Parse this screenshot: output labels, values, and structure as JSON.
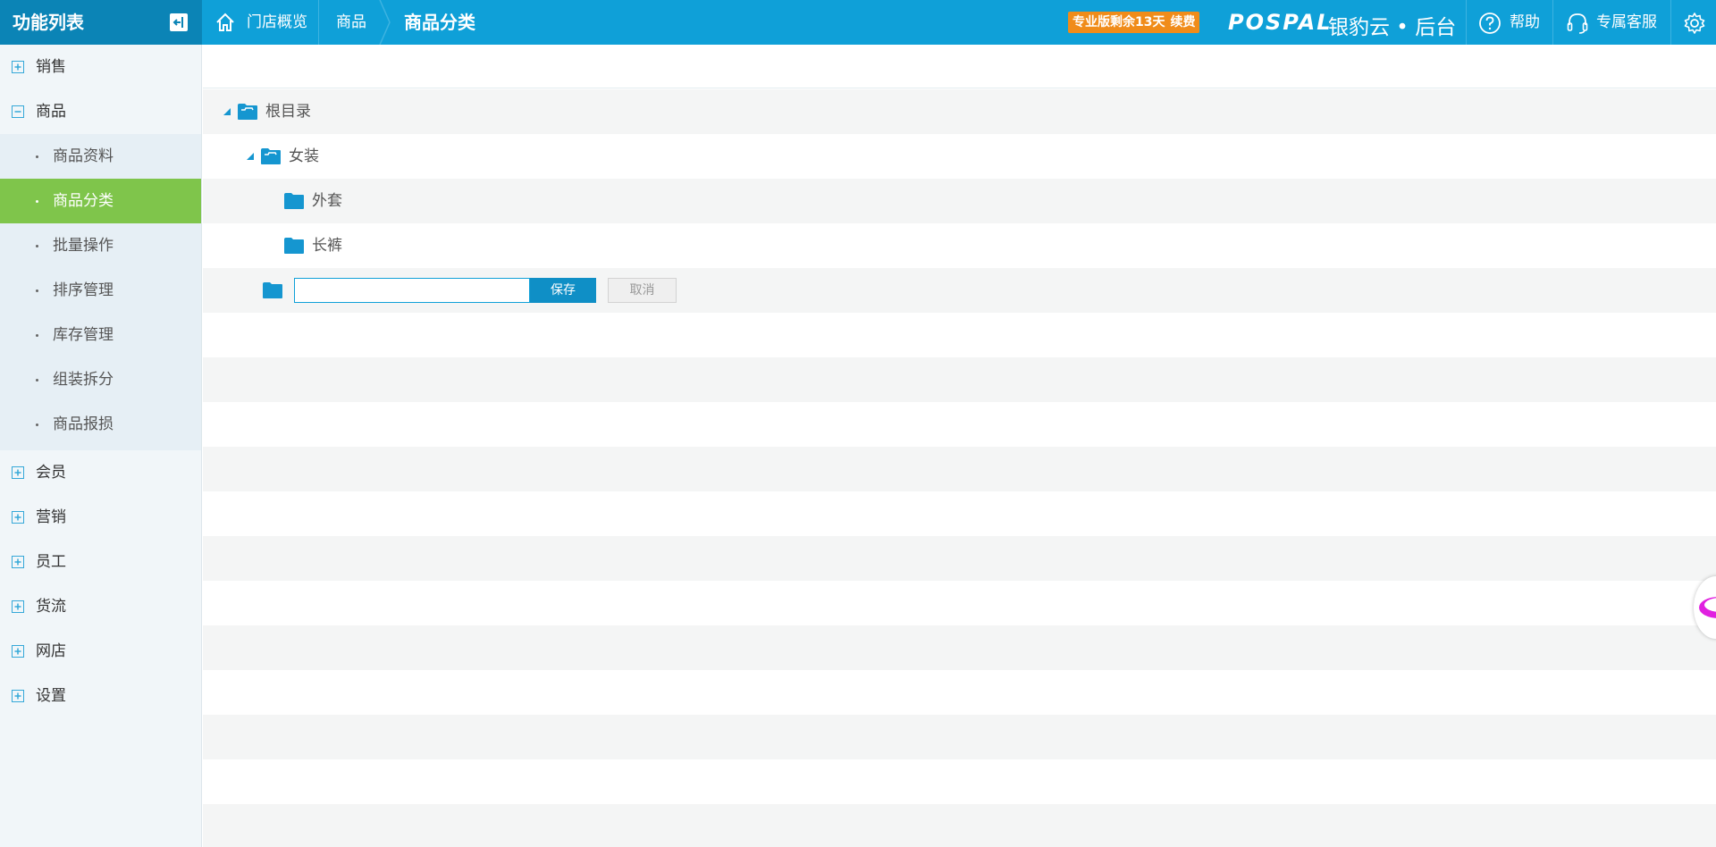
{
  "header": {
    "sidebar_title": "功能列表",
    "breadcrumb": {
      "home": "门店概览",
      "section": "商品",
      "current": "商品分类"
    },
    "trial_badge": {
      "text": "专业版剩余13天",
      "renew": "续费"
    },
    "logo": {
      "brand": "POSPAL",
      "cn": "银豹云 • 后台"
    },
    "help": "帮助",
    "service": "专属客服"
  },
  "sidebar": {
    "groups_top": [
      {
        "label": "销售",
        "expanded": false
      },
      {
        "label": "商品",
        "expanded": true
      }
    ],
    "sub_items": [
      {
        "label": "商品资料",
        "active": false
      },
      {
        "label": "商品分类",
        "active": true
      },
      {
        "label": "批量操作",
        "active": false
      },
      {
        "label": "排序管理",
        "active": false
      },
      {
        "label": "库存管理",
        "active": false
      },
      {
        "label": "组装拆分",
        "active": false
      },
      {
        "label": "商品报损",
        "active": false
      }
    ],
    "groups_bottom": [
      {
        "label": "会员"
      },
      {
        "label": "营销"
      },
      {
        "label": "员工"
      },
      {
        "label": "货流"
      },
      {
        "label": "网店"
      },
      {
        "label": "设置"
      }
    ]
  },
  "tree": {
    "root": "根目录",
    "level1": "女装",
    "children": [
      "外套",
      "长裤"
    ],
    "new_node": {
      "value": "",
      "save": "保存",
      "cancel": "取消"
    }
  },
  "colors": {
    "topbar": "#0fa0d8",
    "sidebar_head": "#0b84b6",
    "active_menu": "#7fc54b",
    "folder": "#1596d0",
    "badge": "#f08c1a"
  }
}
